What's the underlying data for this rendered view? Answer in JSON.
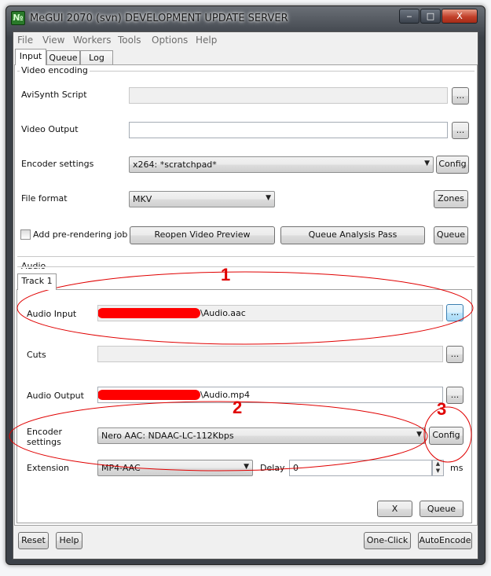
{
  "window": {
    "title": "MeGUI 2070 (svn) DEVELOPMENT UPDATE SERVER",
    "icon_text": "№",
    "controls": {
      "minimize": "‒",
      "maximize": "□",
      "close": "X"
    }
  },
  "menu": [
    "File",
    "View",
    "Workers",
    "Tools",
    "Options",
    "Help"
  ],
  "tabs": [
    "Input",
    "Queue",
    "Log"
  ],
  "video": {
    "group_title": "Video encoding",
    "avisynth_label": "AviSynth Script",
    "avisynth_value": "",
    "video_output_label": "Video Output",
    "video_output_value": "",
    "encoder_label": "Encoder settings",
    "encoder_value": "x264: *scratchpad*",
    "file_format_label": "File format",
    "file_format_value": "MKV",
    "browse": "...",
    "config_label": "Config",
    "zones_label": "Zones",
    "add_prerender_label": "Add pre-rendering job",
    "reopen_preview_label": "Reopen Video Preview",
    "queue_analysis_label": "Queue Analysis Pass",
    "queue_label": "Queue"
  },
  "audio": {
    "group_title": "Audio",
    "track_tab": "Track 1",
    "input_label": "Audio Input",
    "input_value_suffix": "\\Audio.aac",
    "cuts_label": "Cuts",
    "output_label": "Audio Output",
    "output_value_suffix": "\\Audio.mp4",
    "encoder_label_line1": "Encoder",
    "encoder_label_line2": "settings",
    "encoder_value": "Nero AAC: NDAAC-LC-112Kbps",
    "config_label": "Config",
    "extension_label": "Extension",
    "extension_value": "MP4-AAC",
    "delay_label": "Delay",
    "delay_value": "0",
    "delay_unit": "ms",
    "browse": "...",
    "x_label": "X",
    "queue_label": "Queue"
  },
  "annotations": [
    "1",
    "2",
    "3"
  ],
  "annotation_color": "#e00000",
  "bottom": {
    "reset_label": "Reset",
    "help_label": "Help",
    "oneclick_label": "One-Click",
    "autoencode_label": "AutoEncode"
  }
}
